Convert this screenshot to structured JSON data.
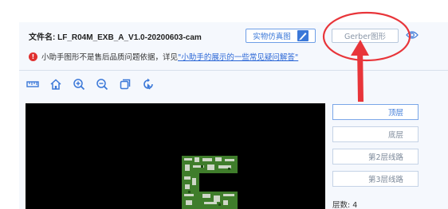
{
  "file": {
    "label": "文件名:",
    "name": "LF_R04M_EXB_A_V1.0-20200603-cam"
  },
  "buttons": {
    "realistic_sim": "实物仿真图",
    "gerber": "Gerber图形"
  },
  "notice": {
    "text": "小助手图形不是售后品质问题依据，详见",
    "link": "\"小助手的展示的一些常见疑问解答\""
  },
  "toolbar": {
    "icons": [
      "ruler-icon",
      "home-icon",
      "zoom-in-icon",
      "zoom-out-icon",
      "copy-icon",
      "rotate-icon"
    ]
  },
  "layers": {
    "items": [
      "顶层",
      "底层",
      "第2层线路",
      "第3层线路"
    ],
    "active_index": 0,
    "count_label": "层数:",
    "count_value": "4"
  },
  "colors": {
    "accent": "#3b78d8",
    "annotation_red": "#e8353a",
    "warning": "#e0302f",
    "canvas_bg": "#000000",
    "pcb_green": "#3f7d2b"
  }
}
